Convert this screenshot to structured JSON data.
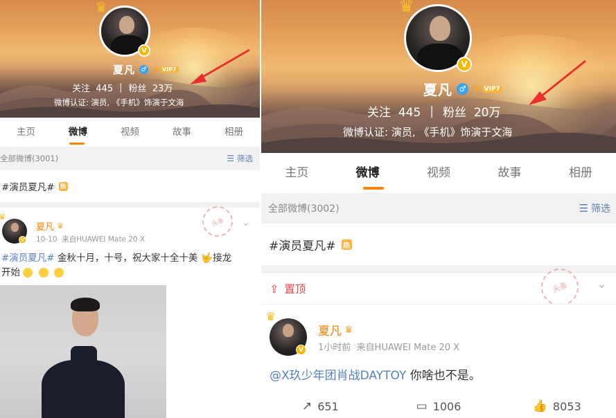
{
  "left": {
    "profile": {
      "name": "夏凡",
      "vip_label": "VIP7",
      "following_label": "关注",
      "following_count": "445",
      "separator": "|",
      "followers_label": "粉丝",
      "followers_count": "23万",
      "verification": "微博认证: 演员, 《手机》饰演于文海"
    },
    "tabs": [
      "主页",
      "微博",
      "视频",
      "故事",
      "相册"
    ],
    "active_tab": "微博",
    "filter": {
      "all_label": "全部微博(3001)",
      "filter_label": "筛选"
    },
    "topic": {
      "text": "#演员夏凡#",
      "hot_label": "热"
    },
    "post": {
      "author": "夏凡",
      "date": "10-10",
      "source": "来自HUAWEI Mate 20 X",
      "hashtag": "#演员夏凡#",
      "text_line1": " 金秋十月，十号，祝大家十全十美",
      "text_line1_end": "接龙",
      "text_line2": "开始",
      "stamp": "头条"
    }
  },
  "right": {
    "profile": {
      "name": "夏凡",
      "vip_label": "VIP7",
      "following_label": "关注",
      "following_count": "445",
      "separator": "|",
      "followers_label": "粉丝",
      "followers_count": "20万",
      "verification": "微博认证: 演员, 《手机》饰演于文海"
    },
    "tabs": [
      "主页",
      "微博",
      "视频",
      "故事",
      "相册"
    ],
    "active_tab": "微博",
    "filter": {
      "all_label": "全部微博(3002)",
      "filter_label": "筛选"
    },
    "topic": {
      "text": "#演员夏凡#",
      "hot_label": "热"
    },
    "pinned_label": "置顶",
    "post": {
      "author": "夏凡",
      "time": "1小时前",
      "source": "来自HUAWEI Mate 20 X",
      "mention": "@X玖少年团肖战DAYTOY",
      "text": "  你啥也不是。",
      "stamp": "头条",
      "reposts": "651",
      "comments": "1006",
      "likes": "8053"
    }
  },
  "colors": {
    "accent_orange": "#ff8200",
    "link_blue": "#5480c2",
    "pin_red": "#e0484a",
    "vip_gold": "#f5b800",
    "annotation_red": "#e8312d"
  },
  "icons": [
    "crown-icon",
    "verified-v-icon",
    "male-icon",
    "vip-crown-icon",
    "filter-icon",
    "hot-badge-icon",
    "pin-icon",
    "chevron-down-icon",
    "repost-icon",
    "comment-icon",
    "like-icon",
    "emoji-icon",
    "arrow-annotation-icon"
  ]
}
